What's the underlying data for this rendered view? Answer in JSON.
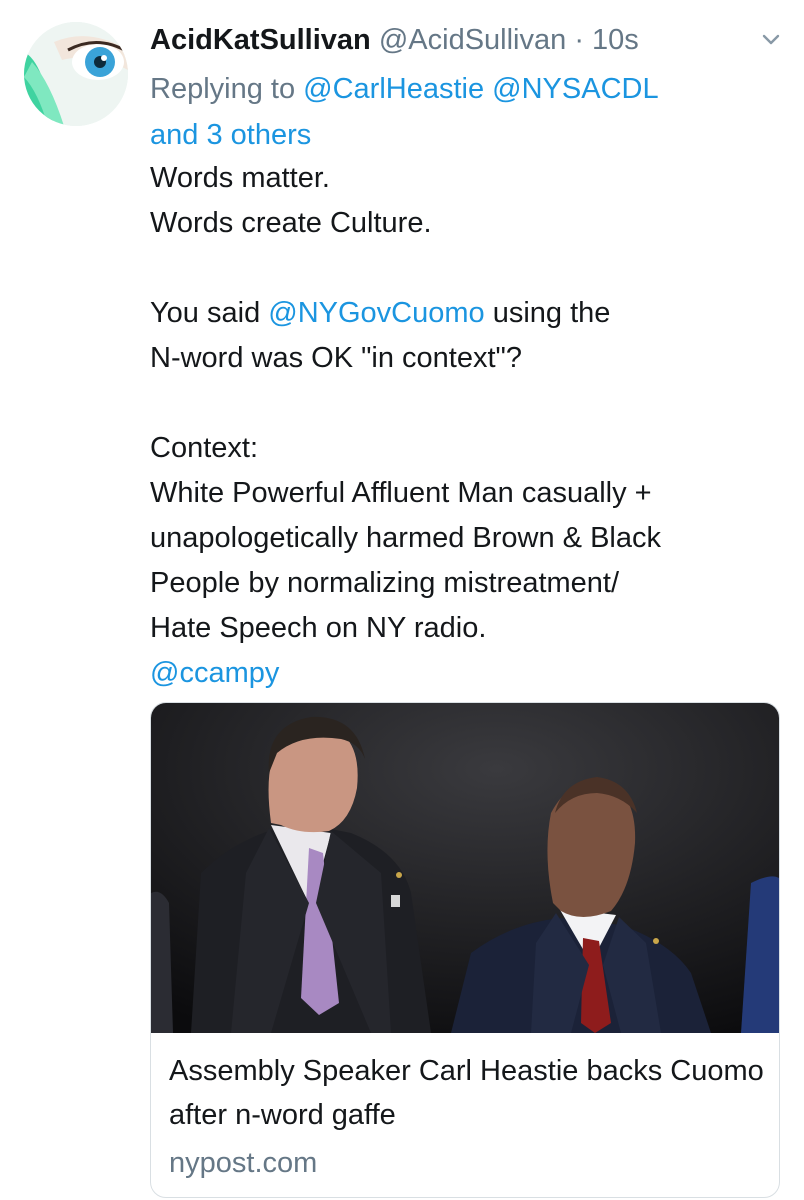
{
  "tweet": {
    "display_name": "AcidKatSullivan",
    "handle": "@AcidSullivan",
    "separator": " · ",
    "time": "10s",
    "replying_prefix": "Replying to ",
    "reply_mentions": [
      "@CarlHeastie",
      "@NYSACDL"
    ],
    "reply_others": "and 3 others",
    "lines": {
      "l1": "Words matter.",
      "l2": "Words create Culture.",
      "l3_before": "You said ",
      "l3_mention": "@NYGovCuomo",
      "l3_after": " using the",
      "l4": "N-word was OK \"in context\"?",
      "l5": "Context:",
      "l6": "White Powerful Affluent Man casually +",
      "l7": "unapologetically harmed Brown & Black",
      "l8": "People by normalizing mistreatment/",
      "l9": "Hate Speech on NY radio.",
      "l10_mention": "@ccampy"
    }
  },
  "link_card": {
    "title": "Assembly Speaker Carl Heastie backs Cuomo after n-word gaffe",
    "domain": "nypost.com"
  },
  "icons": {
    "menu": "chevron-down-icon",
    "avatar": "avatar-eye-image"
  },
  "colors": {
    "link": "#1b95e0",
    "secondary_text": "#657786",
    "primary_text": "#14171a",
    "card_border": "#d9dfe3"
  }
}
